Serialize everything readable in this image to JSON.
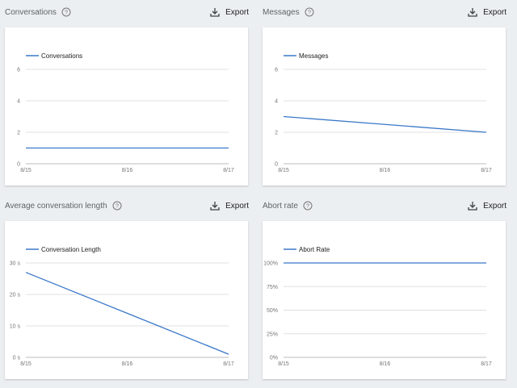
{
  "colors": {
    "line": "#3a78c9",
    "grid": "#e0e0e0",
    "axis": "#bdbdbd"
  },
  "icons": {
    "help": "help-circle-icon",
    "export": "download-icon"
  },
  "panels": [
    {
      "title": "Conversations",
      "export_label": "Export",
      "chart_data": {
        "type": "line",
        "categories": [
          "8/15",
          "8/16",
          "8/17"
        ],
        "series": [
          {
            "name": "Conversations",
            "values": [
              1,
              1,
              1
            ]
          }
        ],
        "ylim": [
          0,
          6
        ],
        "yticks": [
          0,
          2,
          4,
          6
        ],
        "ytick_labels": [
          "0",
          "2",
          "4",
          "6"
        ],
        "legend": "top-left",
        "grid": true
      }
    },
    {
      "title": "Messages",
      "export_label": "Export",
      "chart_data": {
        "type": "line",
        "categories": [
          "8/15",
          "8/16",
          "8/17"
        ],
        "series": [
          {
            "name": "Messages",
            "values": [
              3,
              2.5,
              2
            ]
          }
        ],
        "ylim": [
          0,
          6
        ],
        "yticks": [
          0,
          2,
          4,
          6
        ],
        "ytick_labels": [
          "0",
          "2",
          "4",
          "6"
        ],
        "legend": "top-left",
        "grid": true
      }
    },
    {
      "title": "Average conversation length",
      "export_label": "Export",
      "chart_data": {
        "type": "line",
        "categories": [
          "8/15",
          "8/16",
          "8/17"
        ],
        "series": [
          {
            "name": "Conversation Length",
            "values": [
              27,
              14,
              1
            ]
          }
        ],
        "ylim": [
          0,
          30
        ],
        "yticks": [
          0,
          10,
          20,
          30
        ],
        "ytick_labels": [
          "0 s",
          "10 s",
          "20 s",
          "30 s"
        ],
        "legend": "top-left",
        "grid": true
      }
    },
    {
      "title": "Abort rate",
      "export_label": "Export",
      "chart_data": {
        "type": "line",
        "categories": [
          "8/15",
          "8/16",
          "8/17"
        ],
        "series": [
          {
            "name": "Abort Rate",
            "values": [
              100,
              100,
              100
            ]
          }
        ],
        "ylim": [
          0,
          100
        ],
        "yticks": [
          0,
          25,
          50,
          75,
          100
        ],
        "ytick_labels": [
          "0%",
          "25%",
          "50%",
          "75%",
          "100%"
        ],
        "legend": "top-left",
        "grid": true
      }
    }
  ]
}
